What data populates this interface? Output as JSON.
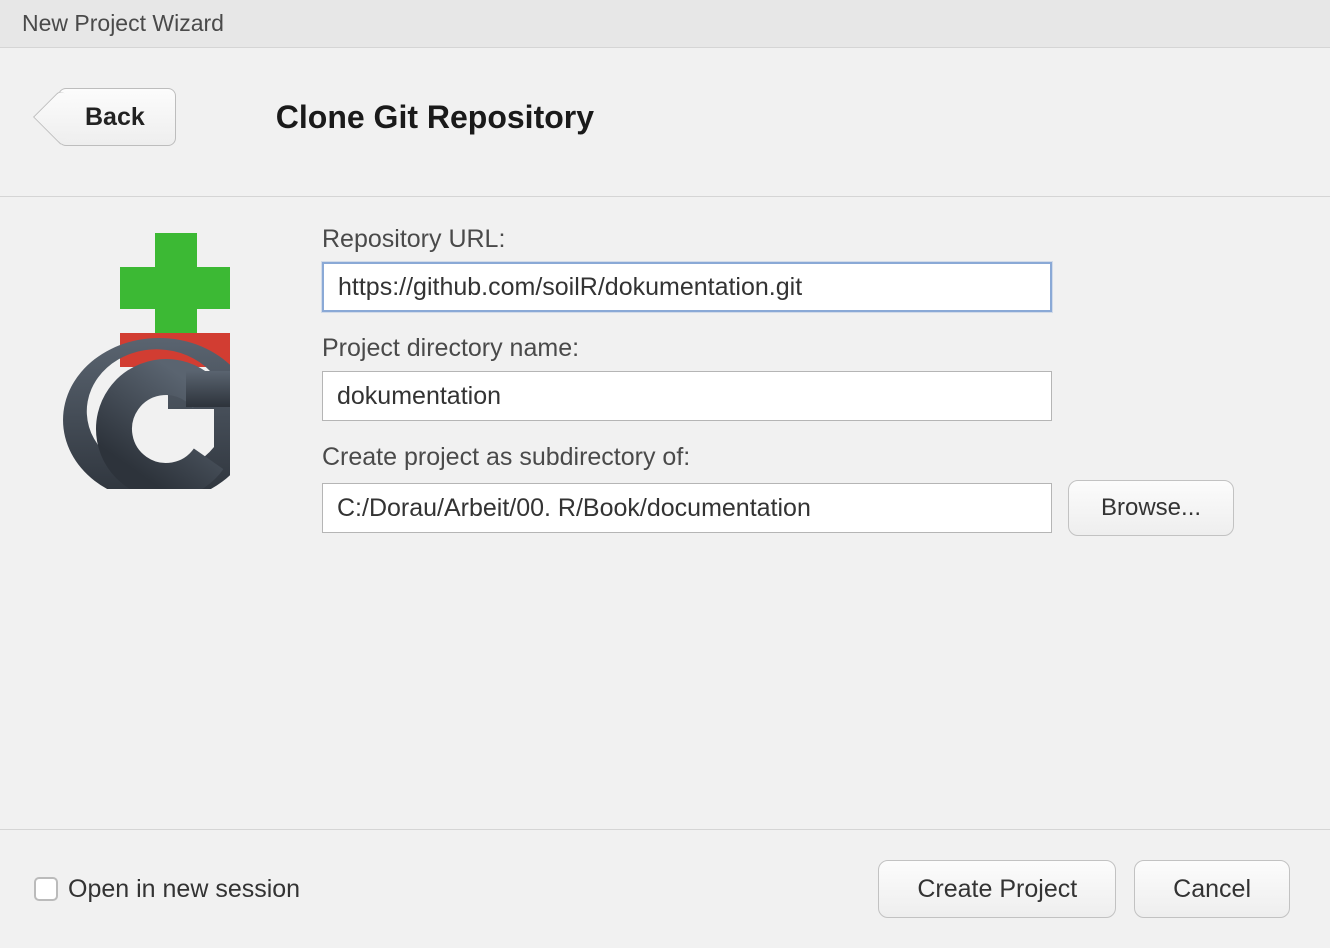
{
  "window": {
    "title": "New Project Wizard"
  },
  "header": {
    "back_label": "Back",
    "page_title": "Clone Git Repository"
  },
  "form": {
    "repo_url_label": "Repository URL:",
    "repo_url_value": "https://github.com/soilR/dokumentation.git",
    "dir_name_label": "Project directory name:",
    "dir_name_value": "dokumentation",
    "subdir_label": "Create project as subdirectory of:",
    "subdir_value": "C:/Dorau/Arbeit/00. R/Book/documentation",
    "browse_label": "Browse..."
  },
  "footer": {
    "open_new_session_label": "Open in new session",
    "open_new_session_checked": false,
    "create_label": "Create Project",
    "cancel_label": "Cancel"
  },
  "colors": {
    "git_green": "#3cb934",
    "git_red": "#d23d32",
    "git_gray_dark": "#3a414a",
    "git_gray_light": "#5a6470"
  }
}
